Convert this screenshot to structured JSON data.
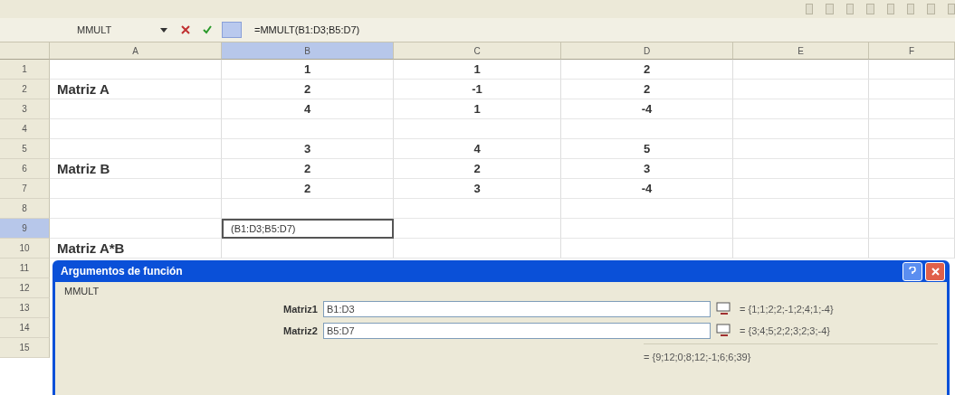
{
  "formula_bar": {
    "name_box": "MMULT",
    "formula": "=MMULT(B1:D3;B5:D7)"
  },
  "columns": [
    {
      "label": "A",
      "selected": false
    },
    {
      "label": "B",
      "selected": true
    },
    {
      "label": "C",
      "selected": false
    },
    {
      "label": "D",
      "selected": false
    },
    {
      "label": "E",
      "selected": false
    },
    {
      "label": "F",
      "selected": false
    }
  ],
  "rows": [
    {
      "number": "1",
      "selected": false,
      "cells": [
        {
          "text": "",
          "active": false
        },
        {
          "text": "1",
          "active": false
        },
        {
          "text": "1",
          "active": false
        },
        {
          "text": "2",
          "active": false
        },
        {
          "text": "",
          "active": false
        },
        {
          "text": "",
          "active": false
        }
      ]
    },
    {
      "number": "2",
      "selected": false,
      "cells": [
        {
          "text": "Matriz A",
          "active": false
        },
        {
          "text": "2",
          "active": false
        },
        {
          "text": "-1",
          "active": false
        },
        {
          "text": "2",
          "active": false
        },
        {
          "text": "",
          "active": false
        },
        {
          "text": "",
          "active": false
        }
      ]
    },
    {
      "number": "3",
      "selected": false,
      "cells": [
        {
          "text": "",
          "active": false
        },
        {
          "text": "4",
          "active": false
        },
        {
          "text": "1",
          "active": false
        },
        {
          "text": "-4",
          "active": false
        },
        {
          "text": "",
          "active": false
        },
        {
          "text": "",
          "active": false
        }
      ]
    },
    {
      "number": "4",
      "selected": false,
      "cells": [
        {
          "text": "",
          "active": false
        },
        {
          "text": "",
          "active": false
        },
        {
          "text": "",
          "active": false
        },
        {
          "text": "",
          "active": false
        },
        {
          "text": "",
          "active": false
        },
        {
          "text": "",
          "active": false
        }
      ]
    },
    {
      "number": "5",
      "selected": false,
      "cells": [
        {
          "text": "",
          "active": false
        },
        {
          "text": "3",
          "active": false
        },
        {
          "text": "4",
          "active": false
        },
        {
          "text": "5",
          "active": false
        },
        {
          "text": "",
          "active": false
        },
        {
          "text": "",
          "active": false
        }
      ]
    },
    {
      "number": "6",
      "selected": false,
      "cells": [
        {
          "text": "Matriz B",
          "active": false
        },
        {
          "text": "2",
          "active": false
        },
        {
          "text": "2",
          "active": false
        },
        {
          "text": "3",
          "active": false
        },
        {
          "text": "",
          "active": false
        },
        {
          "text": "",
          "active": false
        }
      ]
    },
    {
      "number": "7",
      "selected": false,
      "cells": [
        {
          "text": "",
          "active": false
        },
        {
          "text": "2",
          "active": false
        },
        {
          "text": "3",
          "active": false
        },
        {
          "text": "-4",
          "active": false
        },
        {
          "text": "",
          "active": false
        },
        {
          "text": "",
          "active": false
        }
      ]
    },
    {
      "number": "8",
      "selected": false,
      "cells": [
        {
          "text": "",
          "active": false
        },
        {
          "text": "",
          "active": false
        },
        {
          "text": "",
          "active": false
        },
        {
          "text": "",
          "active": false
        },
        {
          "text": "",
          "active": false
        },
        {
          "text": "",
          "active": false
        }
      ]
    },
    {
      "number": "9",
      "selected": true,
      "cells": [
        {
          "text": "",
          "active": false
        },
        {
          "text": "(B1:D3;B5:D7)",
          "active": true
        },
        {
          "text": "",
          "active": false
        },
        {
          "text": "",
          "active": false
        },
        {
          "text": "",
          "active": false
        },
        {
          "text": "",
          "active": false
        }
      ]
    },
    {
      "number": "10",
      "selected": false,
      "cells": [
        {
          "text": "Matriz A*B",
          "active": false
        },
        {
          "text": "",
          "active": false
        },
        {
          "text": "",
          "active": false
        },
        {
          "text": "",
          "active": false
        },
        {
          "text": "",
          "active": false
        },
        {
          "text": "",
          "active": false
        }
      ]
    }
  ],
  "hidden_row_numbers": [
    "11",
    "12",
    "13",
    "14",
    "15"
  ],
  "dialog": {
    "title": "Argumentos de función",
    "function_name": "MMULT",
    "arguments": [
      {
        "label": "Matriz1",
        "value": "B1:D3",
        "result": "= {1;1;2;2;-1;2;4;1;-4}"
      },
      {
        "label": "Matriz2",
        "value": "B5:D7",
        "result": "= {3;4;5;2;2;3;2;3;-4}"
      }
    ],
    "result": "= {9;12;0;8;12;-1;6;6;39}"
  }
}
